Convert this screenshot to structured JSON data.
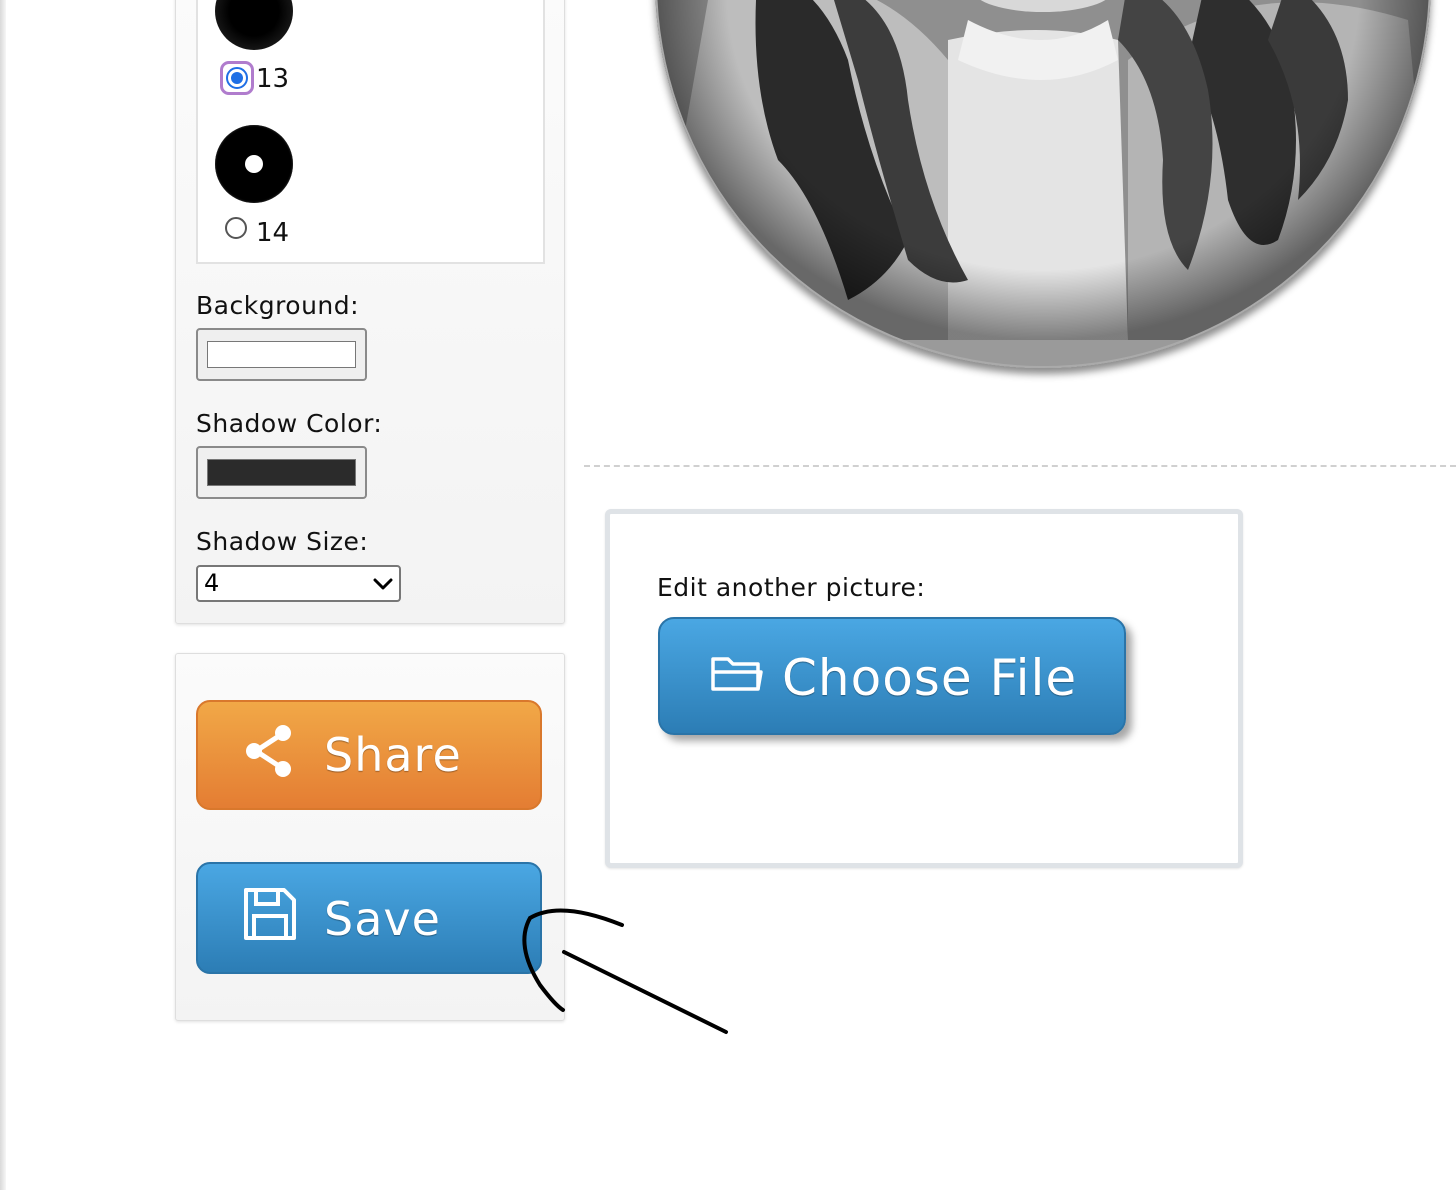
{
  "shape_options": [
    {
      "value_label": "13",
      "selected": true
    },
    {
      "value_label": "14",
      "selected": false
    }
  ],
  "background": {
    "label": "Background:",
    "color": "#ffffff"
  },
  "shadow_color": {
    "label": "Shadow Color:",
    "color": "#2b2b2b"
  },
  "shadow_size": {
    "label": "Shadow Size:",
    "value": "4"
  },
  "actions": {
    "share_label": "Share",
    "save_label": "Save"
  },
  "upload": {
    "label": "Edit another picture:",
    "button_label": "Choose File"
  },
  "colors": {
    "share": "#e98c3a",
    "save": "#3a92cc",
    "radio_selected": "#1f6fe5"
  },
  "icons": {
    "share": "share-icon",
    "save": "floppy-disk-icon",
    "choose": "folder-open-icon"
  }
}
